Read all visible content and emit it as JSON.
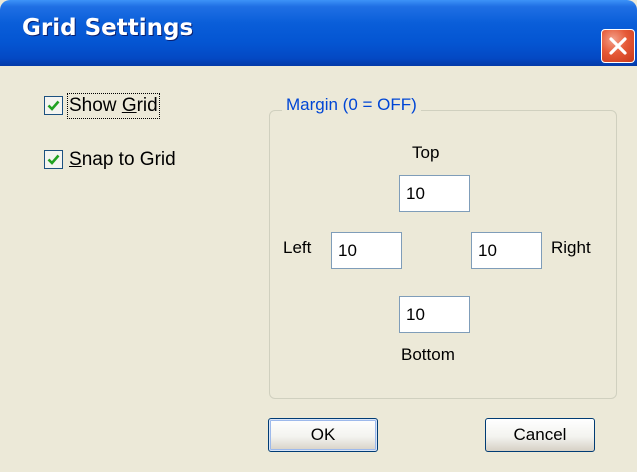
{
  "window": {
    "title": "Grid Settings",
    "close_icon": "close-icon"
  },
  "options": {
    "show_grid": {
      "label_pre": "Show ",
      "label_ul": "G",
      "label_post": "rid",
      "checked": true
    },
    "snap_to_grid": {
      "label_pre": "",
      "label_ul": "S",
      "label_post": "nap to Grid",
      "checked": true
    }
  },
  "margin": {
    "legend": "Margin  (0 = OFF)",
    "top_label": "Top",
    "left_label": "Left",
    "right_label": "Right",
    "bottom_label": "Bottom",
    "top_value": "10",
    "left_value": "10",
    "right_value": "10",
    "bottom_value": "10"
  },
  "buttons": {
    "ok": "OK",
    "cancel": "Cancel"
  },
  "colors": {
    "title_bar": "#0455d2",
    "dialog_bg": "#ece9d8",
    "legend_text": "#0046d5",
    "close_button": "#e65a38"
  }
}
